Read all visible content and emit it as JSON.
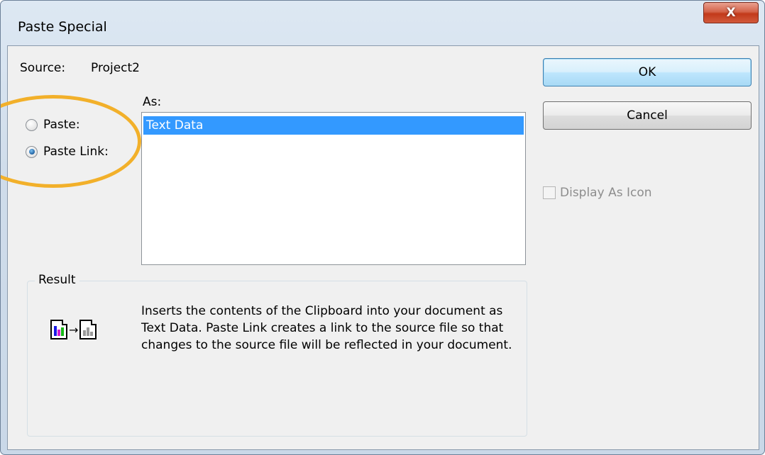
{
  "window": {
    "title": "Paste Special",
    "close_label": "X"
  },
  "source": {
    "label": "Source:",
    "value": "Project2"
  },
  "as": {
    "label": "As:",
    "items": [
      "Text Data"
    ],
    "selected": "Text Data"
  },
  "options": {
    "paste_label": "Paste:",
    "paste_link_label": "Paste Link:",
    "selected": "Paste Link:"
  },
  "buttons": {
    "ok": "OK",
    "cancel": "Cancel"
  },
  "display_as_icon": {
    "label": "Display As Icon",
    "checked": false,
    "enabled": false
  },
  "result": {
    "label": "Result",
    "text": "Inserts the contents of the Clipboard into your document as Text Data.  Paste Link creates a link to the source file so that changes to the source file will be reflected in your document.",
    "icon": "paste-link-icon"
  },
  "colors": {
    "selection": "#3399ff",
    "highlight_annotation": "#f2b02a",
    "close_button": "#c2391a"
  }
}
